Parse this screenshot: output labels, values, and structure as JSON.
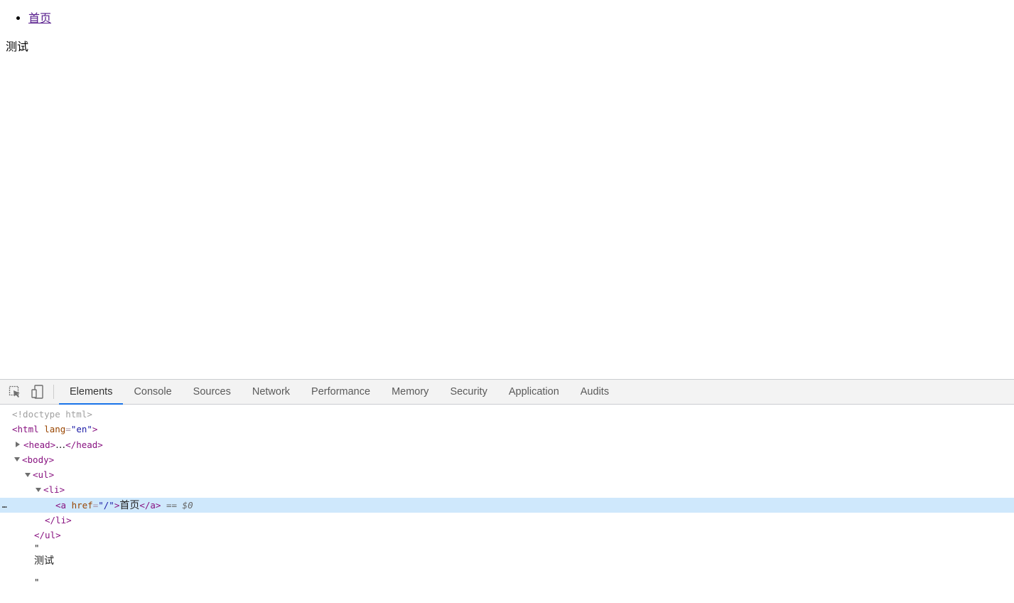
{
  "page": {
    "nav_link": "首页",
    "body_text": "测试"
  },
  "devtools": {
    "icons": {
      "inspect": "inspect-element-icon",
      "device": "device-toolbar-icon"
    },
    "tabs": [
      "Elements",
      "Console",
      "Sources",
      "Network",
      "Performance",
      "Memory",
      "Security",
      "Application",
      "Audits"
    ],
    "active_tab": "Elements",
    "tree": {
      "doctype": "<!doctype html>",
      "html_open_start": "<html",
      "html_attr_name": "lang",
      "html_attr_value": "\"en\"",
      "html_open_end": ">",
      "head_open": "<head>",
      "head_ellipsis": "…",
      "head_close": "</head>",
      "body_open": "<body>",
      "ul_open": "<ul>",
      "li_open": "<li>",
      "a_open_start": "<a",
      "a_attr_name": "href",
      "a_attr_eq": "=",
      "a_attr_value": "\"/\"",
      "a_open_end": ">",
      "a_text": "首页",
      "a_close": "</a>",
      "selected_marker": "== $0",
      "li_close": "</li>",
      "ul_close": "</ul>",
      "quote_open": "\"",
      "text_node": "测试",
      "quote_close": "\""
    },
    "row_menu": "…"
  }
}
